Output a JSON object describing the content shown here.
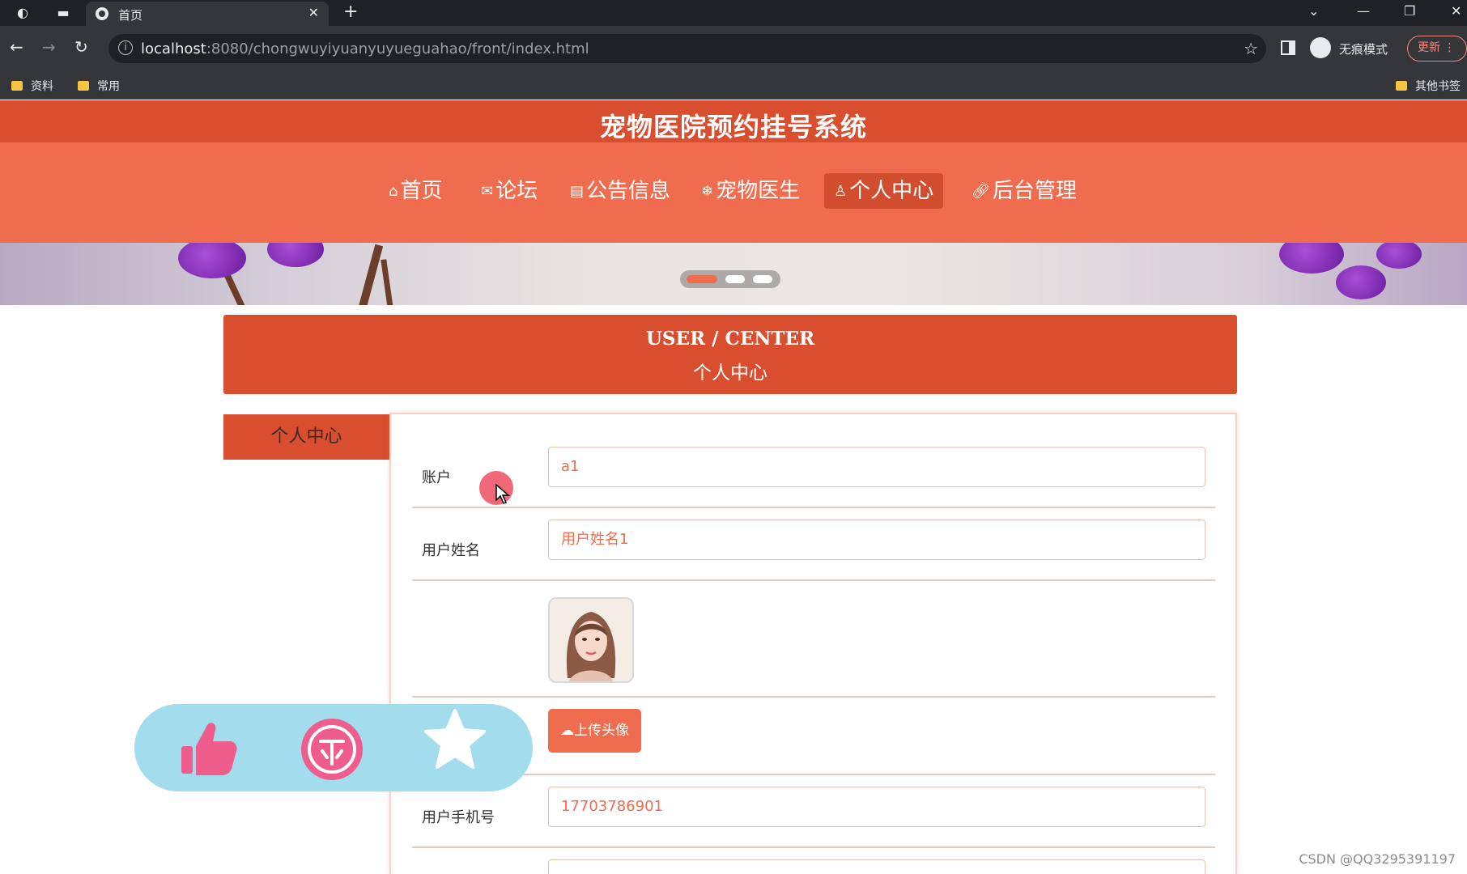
{
  "browser": {
    "tab_title": "首页",
    "url_host": "localhost",
    "url_rest": ":8080/chongwuyiyuanyuyueguahao/front/index.html",
    "incognito_label": "无痕模式",
    "update_label": "更新",
    "bookmarks": [
      "资料",
      "常用"
    ],
    "other_bookmarks": "其他书签"
  },
  "site": {
    "title": "宠物医院预约挂号系统",
    "nav": [
      {
        "label": "首页",
        "icon": "home-icon"
      },
      {
        "label": "论坛",
        "icon": "mail-icon"
      },
      {
        "label": "公告信息",
        "icon": "notice-icon"
      },
      {
        "label": "宠物医生",
        "icon": "snowflake-icon"
      },
      {
        "label": "个人中心",
        "icon": "user-icon",
        "active": true
      },
      {
        "label": "后台管理",
        "icon": "link-icon"
      }
    ],
    "carousel": {
      "slides": 3,
      "active_index": 0
    }
  },
  "user_center": {
    "title_en": "USER / CENTER",
    "title_cn": "个人中心",
    "side_menu": [
      "个人中心"
    ]
  },
  "form": {
    "account_label": "账户",
    "account_value": "a1",
    "name_label": "用户姓名",
    "name_value": "用户姓名1",
    "upload_label": "上传头像",
    "phone_label": "用户手机号",
    "phone_value": "17703786901"
  },
  "floating_actions": [
    "like-icon",
    "coin-icon",
    "favorite-icon"
  ],
  "watermark": "CSDN @QQ3295391197",
  "colors": {
    "primary": "#d94e2f",
    "nav": "#ef6c4e",
    "floating_bar": "#a3dded",
    "pink": "#ee5d8c"
  }
}
